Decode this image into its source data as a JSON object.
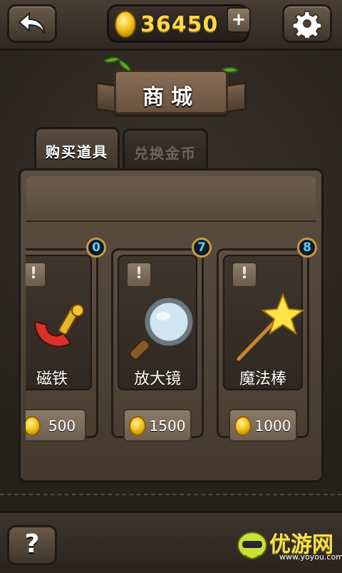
{
  "topbar": {
    "back_icon": "back-arrow-icon",
    "coins": "36450",
    "add_label": "+",
    "settings_icon": "gear-icon"
  },
  "banner": {
    "title": "商城"
  },
  "tabs": [
    {
      "label": "购买道具",
      "active": true
    },
    {
      "label": "兑换金币",
      "active": false
    }
  ],
  "items": [
    {
      "name": "磁铁",
      "count": "0",
      "price": "500",
      "icon": "magnet-icon"
    },
    {
      "name": "放大镜",
      "count": "7",
      "price": "1500",
      "icon": "magnifier-icon"
    },
    {
      "name": "魔法棒",
      "count": "8",
      "price": "1000",
      "icon": "magic-wand-icon"
    }
  ],
  "info_glyph": "!",
  "help_label": "?",
  "watermark": {
    "text": "优游网",
    "sub": "www.yoyou.com"
  },
  "colors": {
    "coin_text": "#ffd84a",
    "badge_text": "#58d3ff"
  }
}
